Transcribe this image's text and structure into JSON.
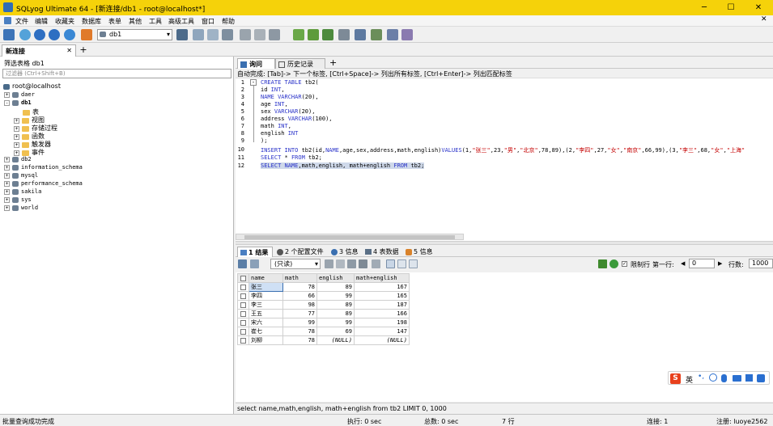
{
  "window": {
    "title": "SQLyog Ultimate 64 - [新连接/db1 - root@localhost*]",
    "controls": {
      "minimize": "─",
      "maximize": "☐",
      "close": "✕"
    }
  },
  "menu": [
    "文件",
    "编辑",
    "收藏夹",
    "数据库",
    "表单",
    "其他",
    "工具",
    "高级工具",
    "窗口",
    "帮助"
  ],
  "toolbar": {
    "db_selected": "db1"
  },
  "connection_tab": {
    "label": "新连接",
    "close": "✕",
    "add": "+"
  },
  "object_browser": {
    "filter_label": "筛选表格 db1",
    "filter_placeholder": "过滤器 (Ctrl+Shift+B)",
    "root": "root@localhost",
    "databases_before": [
      "daer"
    ],
    "active_db": "db1",
    "db1_children": [
      "表",
      "视图",
      "存储过程",
      "函数",
      "触发器",
      "事件"
    ],
    "databases_after": [
      "db2",
      "information_schema",
      "mysql",
      "performance_schema",
      "sakila",
      "sys",
      "world"
    ]
  },
  "editor": {
    "tabs": [
      "询问",
      "历史记录"
    ],
    "add_tab": "+",
    "hint": "自动完成: [Tab]-> 下一个标签, [Ctrl+Space]-> 列出所有标签, [Ctrl+Enter]-> 列出匹配标签",
    "line_numbers": [
      "1",
      "2",
      "3",
      "4",
      "5",
      "6",
      "7",
      "8",
      "9",
      "10",
      "11",
      "12"
    ],
    "code": {
      "l1_kw": "CREATE TABLE",
      "l1_rest": " tb2(",
      "l2": "id ",
      "l2_kw": "INT",
      "l2_end": ",",
      "l3_kw": "NAME VARCHAR",
      "l3_rest": "(20),",
      "l4": "age ",
      "l4_kw": "INT",
      "l4_end": ",",
      "l5": "sex ",
      "l5_kw": "VARCHAR",
      "l5_rest": "(20),",
      "l6": "address ",
      "l6_kw": "VARCHAR",
      "l6_rest": "(100),",
      "l7": "math ",
      "l7_kw": "INT",
      "l7_end": ",",
      "l8": "english ",
      "l8_kw": "INT",
      "l9": ");",
      "l10_kw": "INSERT INTO",
      "l10_a": " tb2(id,",
      "l10_kw2": "NAME",
      "l10_b": ",age,sex,address,math,english)",
      "l10_kw3": "VALUES",
      "l10_c": "(1,",
      "l10_s1": "\"张三\"",
      "l10_d": ",23,",
      "l10_s2": "\"男\"",
      "l10_e": ",",
      "l10_s3": "\"北京\"",
      "l10_f": ",78,89),(2,",
      "l10_s4": "\"李四\"",
      "l10_g": ",27,",
      "l10_s5": "\"女\"",
      "l10_h": ",",
      "l10_s6": "\"南京\"",
      "l10_i": ",66,99),(3,",
      "l10_s7": "\"李三\"",
      "l10_j": ",68,",
      "l10_s8": "\"女\"",
      "l10_k": ",",
      "l10_s9": "\"上海\"",
      "l11_kw": "SELECT",
      "l11_rest": " * ",
      "l11_kw2": "FROM",
      "l11_end": " tb2;",
      "l12_kw": "SELECT NAME",
      "l12_rest": ",math,english, math+english ",
      "l12_kw2": "FROM",
      "l12_end": " tb2;"
    }
  },
  "results": {
    "tabs": [
      "1 结果",
      "2 个配置文件",
      "3 信息",
      "4 表数据",
      "5 信息"
    ],
    "mode": "(只读)",
    "limit_label": "限制行",
    "first_row_label": "第一行:",
    "first_row_value": "0",
    "rows_label": "行数:",
    "rows_value": "1000",
    "columns": [
      "name",
      "math",
      "english",
      "math+english"
    ],
    "rows": [
      [
        "张三",
        "78",
        "89",
        "167"
      ],
      [
        "李四",
        "66",
        "99",
        "165"
      ],
      [
        "李三",
        "98",
        "89",
        "187"
      ],
      [
        "王五",
        "77",
        "89",
        "166"
      ],
      [
        "宋六",
        "99",
        "99",
        "198"
      ],
      [
        "崔七",
        "78",
        "69",
        "147"
      ],
      [
        "刘柳",
        "78",
        "(NULL)",
        "(NULL)"
      ]
    ]
  },
  "sql_status": "select name,math,english, math+english from tb2 LIMIT 0, 1000",
  "status_bar": {
    "left": "批量查询成功完成",
    "exec": "执行: 0 sec",
    "total": "总数: 0 sec",
    "rows": "7 行",
    "connections": "连接: 1",
    "register": "注册: luoye2562"
  },
  "ime": {
    "brand": "S",
    "lang": "英"
  },
  "colors": {
    "titlebar": "#f5d20a",
    "keyword": "#2a33c9",
    "string": "#c40000",
    "selection": "#cfd9ea"
  }
}
